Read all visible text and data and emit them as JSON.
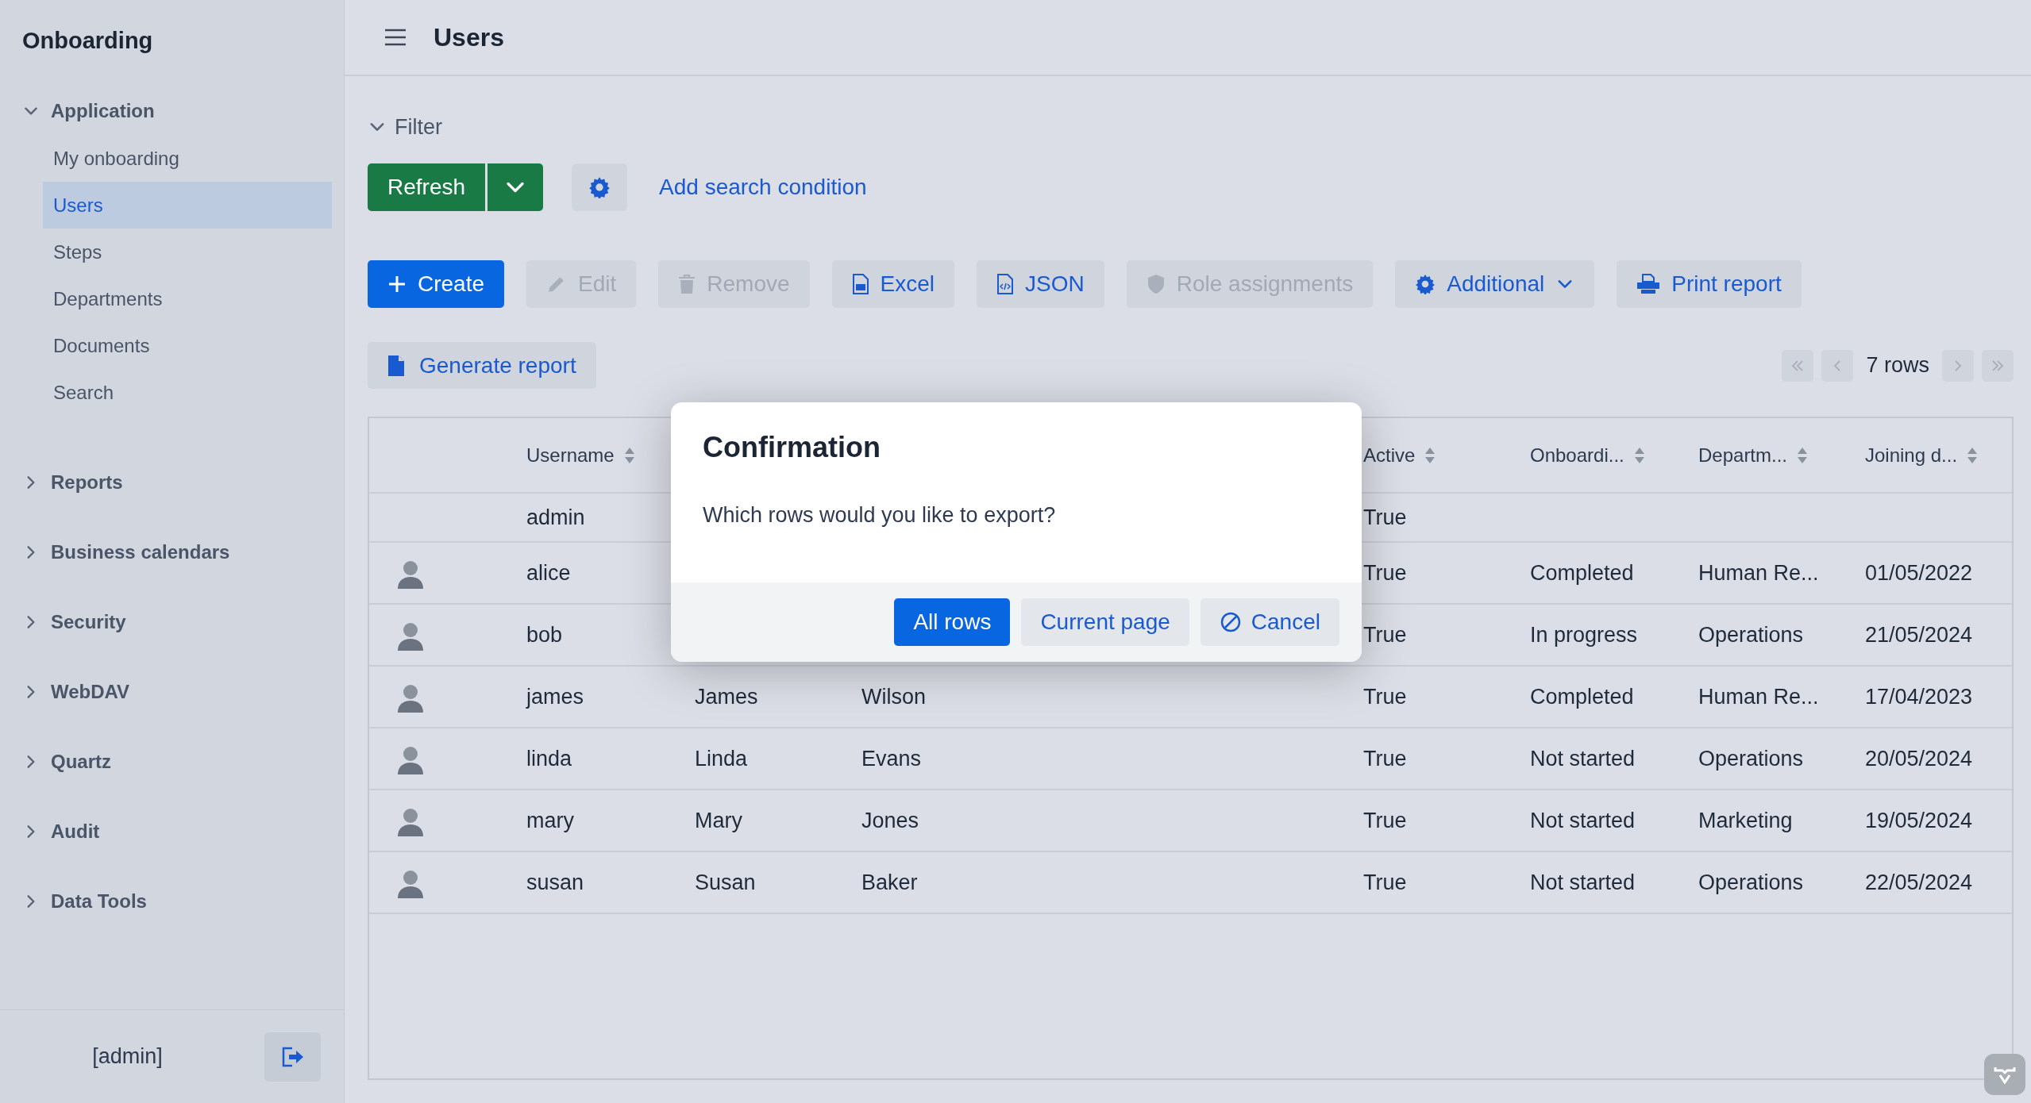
{
  "sidebar": {
    "title": "Onboarding",
    "groups": [
      {
        "label": "Application",
        "expanded": true,
        "items": [
          {
            "label": "My onboarding",
            "selected": false
          },
          {
            "label": "Users",
            "selected": true
          },
          {
            "label": "Steps",
            "selected": false
          },
          {
            "label": "Departments",
            "selected": false
          },
          {
            "label": "Documents",
            "selected": false
          },
          {
            "label": "Search",
            "selected": false
          }
        ]
      },
      {
        "label": "Reports",
        "expanded": false
      },
      {
        "label": "Business calendars",
        "expanded": false
      },
      {
        "label": "Security",
        "expanded": false
      },
      {
        "label": "WebDAV",
        "expanded": false
      },
      {
        "label": "Quartz",
        "expanded": false
      },
      {
        "label": "Audit",
        "expanded": false
      },
      {
        "label": "Data Tools",
        "expanded": false
      }
    ],
    "user": "[admin]"
  },
  "header": {
    "title": "Users"
  },
  "filter": {
    "label": "Filter",
    "expanded": true,
    "refresh": "Refresh",
    "add_condition": "Add search condition"
  },
  "toolbar": [
    {
      "label": "Create",
      "kind": "primary",
      "disabled": false
    },
    {
      "label": "Edit",
      "kind": "secondary",
      "disabled": true
    },
    {
      "label": "Remove",
      "kind": "secondary",
      "disabled": true
    },
    {
      "label": "Excel",
      "kind": "secondary",
      "disabled": false
    },
    {
      "label": "JSON",
      "kind": "secondary",
      "disabled": false
    },
    {
      "label": "Role assignments",
      "kind": "secondary",
      "disabled": true
    },
    {
      "label": "Additional",
      "kind": "dropdown",
      "disabled": false
    },
    {
      "label": "Print report",
      "kind": "secondary",
      "disabled": false
    }
  ],
  "generate_report": "Generate report",
  "pagination": {
    "rows": "7 rows"
  },
  "table": {
    "columns": [
      {
        "label": "Username"
      },
      {
        "label": "Active"
      },
      {
        "label": "Onboardi..."
      },
      {
        "label": "Departm..."
      },
      {
        "label": "Joining d..."
      }
    ],
    "rows": [
      {
        "avatar": false,
        "username": "admin",
        "active": "True"
      },
      {
        "avatar": true,
        "username": "alice",
        "active": "True",
        "onboarding": "Completed",
        "department": "Human Re...",
        "joining_date": "01/05/2022"
      },
      {
        "avatar": true,
        "username": "bob",
        "active": "True",
        "onboarding": "In progress",
        "department": "Operations",
        "joining_date": "21/05/2024"
      },
      {
        "avatar": true,
        "username": "james",
        "column_3": "James",
        "column_4": "Wilson",
        "active": "True",
        "onboarding": "Completed",
        "department": "Human Re...",
        "joining_date": "17/04/2023"
      },
      {
        "avatar": true,
        "username": "linda",
        "column_3": "Linda",
        "column_4": "Evans",
        "active": "True",
        "onboarding": "Not started",
        "department": "Operations",
        "joining_date": "20/05/2024"
      },
      {
        "avatar": true,
        "username": "mary",
        "column_3": "Mary",
        "column_4": "Jones",
        "active": "True",
        "onboarding": "Not started",
        "department": "Marketing",
        "joining_date": "19/05/2024"
      },
      {
        "avatar": true,
        "username": "susan",
        "column_3": "Susan",
        "column_4": "Baker",
        "active": "True",
        "onboarding": "Not started",
        "department": "Operations",
        "joining_date": "22/05/2024"
      }
    ]
  },
  "dialog": {
    "title": "Confirmation",
    "message": "Which rows would you like to export?",
    "buttons": [
      {
        "label": "All rows",
        "kind": "primary"
      },
      {
        "label": "Current page",
        "kind": "secondary"
      },
      {
        "label": "Cancel",
        "kind": "cancel"
      }
    ]
  }
}
